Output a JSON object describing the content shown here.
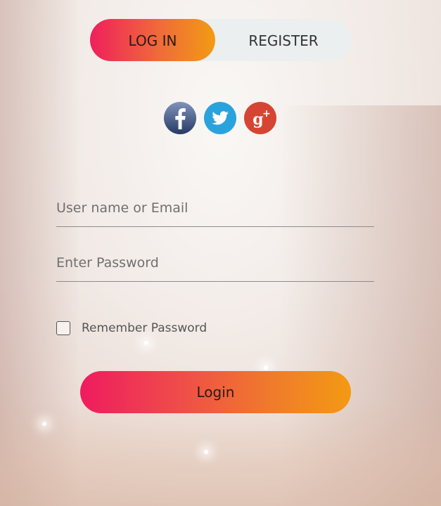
{
  "tabs": {
    "login_label": "LOG IN",
    "register_label": "REGISTER"
  },
  "social": {
    "facebook_icon": "facebook-icon",
    "twitter_icon": "twitter-icon",
    "google_plus_icon": "google-plus-icon"
  },
  "form": {
    "username_placeholder": "User name or Email",
    "password_placeholder": "Enter Password",
    "remember_label": "Remember Password",
    "remember_checked": false,
    "submit_label": "Login"
  },
  "colors": {
    "gradient_start": "#ef1f5c",
    "gradient_end": "#f29b13",
    "facebook": "#3b5998",
    "twitter": "#2aa3dd",
    "google_plus": "#d64533"
  }
}
